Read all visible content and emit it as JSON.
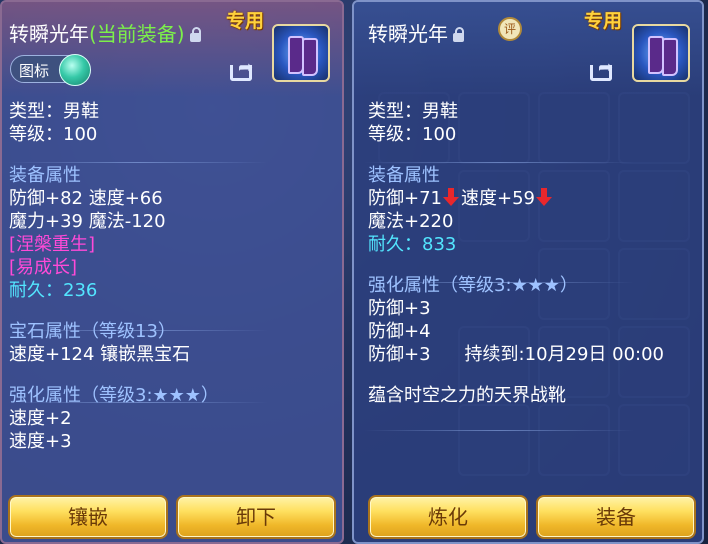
{
  "left_panel": {
    "title": "转瞬光年",
    "current_tag": "(当前装备)",
    "exclusive": "专用",
    "toggle_label": "图标",
    "lines": [
      {
        "text": "类型：男鞋",
        "style": "white"
      },
      {
        "text": "等级：100",
        "style": "white"
      },
      {
        "text": "装备属性",
        "style": "sec"
      },
      {
        "text": "防御+82 速度+66",
        "style": "white"
      },
      {
        "text": "魔力+39 魔法-120",
        "style": "white"
      },
      {
        "text": "[涅槃重生]",
        "style": "mag"
      },
      {
        "text": "[易成长]",
        "style": "mag"
      },
      {
        "text": "耐久：236",
        "style": "cyan"
      },
      {
        "text": "宝石属性（等级13）",
        "style": "sec"
      },
      {
        "text": "速度+124 镶嵌黑宝石",
        "style": "white"
      },
      {
        "text": "强化属性（等级3:★★★）",
        "style": "sec"
      },
      {
        "text": "速度+2",
        "style": "white"
      },
      {
        "text": "速度+3",
        "style": "white"
      }
    ],
    "buttons": {
      "inlay": "镶嵌",
      "unequip": "卸下"
    }
  },
  "right_panel": {
    "title": "转瞬光年",
    "rate_badge": "评",
    "exclusive": "专用",
    "type_line": "类型：男鞋",
    "level_line": "等级：100",
    "equip_attr_title": "装备属性",
    "defense": "防御+71",
    "speed": "速度+59",
    "magic": "魔法+220",
    "durability": "耐久：833",
    "enhance_title": "强化属性（等级3:★★★）",
    "enhance_1": "防御+3",
    "enhance_2": "防御+4",
    "enhance_3": "防御+3",
    "duration": "持续到:10月29日 00:00",
    "description": "蕴含时空之力的天界战靴",
    "buttons": {
      "refine": "炼化",
      "equip": "装备"
    }
  },
  "colors": {
    "section_title": "#9ec2ff",
    "durability": "#53e6ff",
    "special": "#ff4ad8",
    "current_equipped": "#7cf04a",
    "exclusive": "#ffd23c",
    "down_arrow": "#e9272c"
  },
  "icons": [
    "lock-icon",
    "share-icon",
    "rate-badge",
    "boots-item-icon",
    "toggle-knob",
    "down-arrow-icon"
  ]
}
